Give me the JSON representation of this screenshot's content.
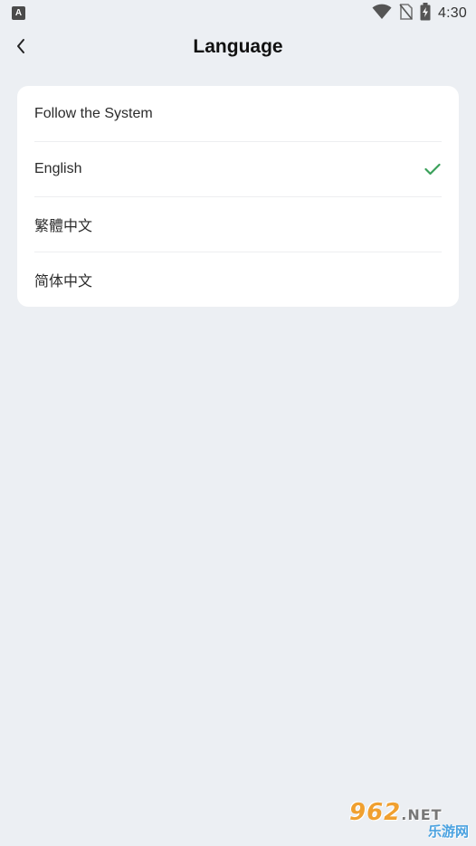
{
  "status_bar": {
    "left_icon": "A",
    "icons": [
      "wifi-icon",
      "no-sim-icon",
      "battery-charging-icon"
    ],
    "time": "4:30"
  },
  "header": {
    "back_icon": "chevron-left-icon",
    "title": "Language"
  },
  "languages": [
    {
      "label": "Follow the System",
      "selected": false
    },
    {
      "label": "English",
      "selected": true
    },
    {
      "label": "繁體中文",
      "selected": false
    },
    {
      "label": "简体中文",
      "selected": false
    }
  ],
  "colors": {
    "background": "#eceff3",
    "card": "#ffffff",
    "check": "#3aa05a"
  },
  "watermark": {
    "top": "962",
    "suffix": ".NET",
    "bottom": "乐游网"
  }
}
